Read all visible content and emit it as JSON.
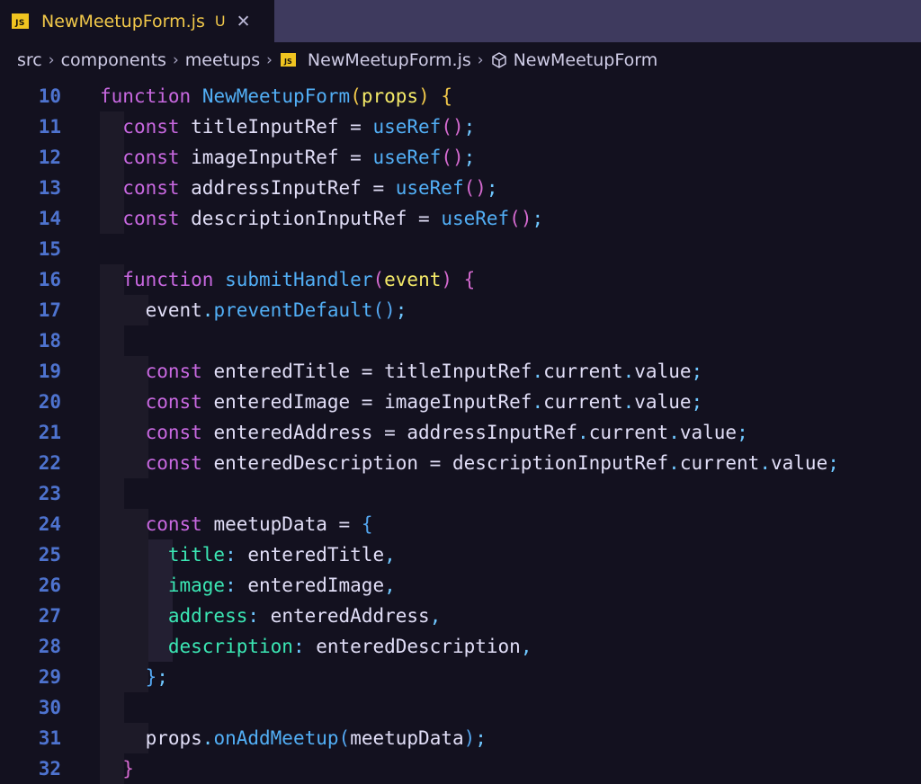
{
  "tab": {
    "badge": "JS",
    "filename": "NewMeetupForm.js",
    "status": "U",
    "close": "✕"
  },
  "breadcrumb": {
    "items": [
      "src",
      "components",
      "meetups",
      "NewMeetupForm.js",
      "NewMeetupForm"
    ],
    "separator": "›",
    "badge": "JS"
  },
  "colors": {
    "keyword": "#c868e0",
    "function": "#52aff6",
    "param": "#f4ea68",
    "property": "#3be7b4",
    "line_number": "#4e73cf",
    "tab_accent": "#f1c84a"
  },
  "editor": {
    "lines": [
      {
        "number": "10",
        "tokens": [
          [
            "kw",
            "function"
          ],
          [
            "tx",
            " "
          ],
          [
            "fn",
            "NewMeetupForm"
          ],
          [
            "br",
            "("
          ],
          [
            "pm",
            "props"
          ],
          [
            "br",
            ")"
          ],
          [
            "tx",
            " "
          ],
          [
            "br",
            "{"
          ]
        ]
      },
      {
        "number": "11",
        "tokens": [
          [
            "tx",
            "  "
          ],
          [
            "kw",
            "const"
          ],
          [
            "tx",
            " titleInputRef = "
          ],
          [
            "fn",
            "useRef"
          ],
          [
            "br2",
            "()"
          ],
          [
            "pu",
            ";"
          ]
        ]
      },
      {
        "number": "12",
        "tokens": [
          [
            "tx",
            "  "
          ],
          [
            "kw",
            "const"
          ],
          [
            "tx",
            " imageInputRef = "
          ],
          [
            "fn",
            "useRef"
          ],
          [
            "br2",
            "()"
          ],
          [
            "pu",
            ";"
          ]
        ]
      },
      {
        "number": "13",
        "tokens": [
          [
            "tx",
            "  "
          ],
          [
            "kw",
            "const"
          ],
          [
            "tx",
            " addressInputRef = "
          ],
          [
            "fn",
            "useRef"
          ],
          [
            "br2",
            "()"
          ],
          [
            "pu",
            ";"
          ]
        ]
      },
      {
        "number": "14",
        "tokens": [
          [
            "tx",
            "  "
          ],
          [
            "kw",
            "const"
          ],
          [
            "tx",
            " descriptionInputRef = "
          ],
          [
            "fn",
            "useRef"
          ],
          [
            "br2",
            "()"
          ],
          [
            "pu",
            ";"
          ]
        ]
      },
      {
        "number": "15",
        "tokens": []
      },
      {
        "number": "16",
        "tokens": [
          [
            "tx",
            "  "
          ],
          [
            "kw",
            "function"
          ],
          [
            "tx",
            " "
          ],
          [
            "fn",
            "submitHandler"
          ],
          [
            "br2",
            "("
          ],
          [
            "pm",
            "event"
          ],
          [
            "br2",
            ")"
          ],
          [
            "tx",
            " "
          ],
          [
            "br2",
            "{"
          ]
        ]
      },
      {
        "number": "17",
        "tokens": [
          [
            "tx",
            "    event"
          ],
          [
            "pu",
            "."
          ],
          [
            "fn",
            "preventDefault"
          ],
          [
            "br3",
            "()"
          ],
          [
            "pu",
            ";"
          ]
        ]
      },
      {
        "number": "18",
        "tokens": []
      },
      {
        "number": "19",
        "tokens": [
          [
            "tx",
            "    "
          ],
          [
            "kw",
            "const"
          ],
          [
            "tx",
            " enteredTitle = titleInputRef"
          ],
          [
            "pu",
            "."
          ],
          [
            "tx",
            "current"
          ],
          [
            "pu",
            "."
          ],
          [
            "tx",
            "value"
          ],
          [
            "pu",
            ";"
          ]
        ]
      },
      {
        "number": "20",
        "tokens": [
          [
            "tx",
            "    "
          ],
          [
            "kw",
            "const"
          ],
          [
            "tx",
            " enteredImage = imageInputRef"
          ],
          [
            "pu",
            "."
          ],
          [
            "tx",
            "current"
          ],
          [
            "pu",
            "."
          ],
          [
            "tx",
            "value"
          ],
          [
            "pu",
            ";"
          ]
        ]
      },
      {
        "number": "21",
        "tokens": [
          [
            "tx",
            "    "
          ],
          [
            "kw",
            "const"
          ],
          [
            "tx",
            " enteredAddress = addressInputRef"
          ],
          [
            "pu",
            "."
          ],
          [
            "tx",
            "current"
          ],
          [
            "pu",
            "."
          ],
          [
            "tx",
            "value"
          ],
          [
            "pu",
            ";"
          ]
        ]
      },
      {
        "number": "22",
        "tokens": [
          [
            "tx",
            "    "
          ],
          [
            "kw",
            "const"
          ],
          [
            "tx",
            " enteredDescription = descriptionInputRef"
          ],
          [
            "pu",
            "."
          ],
          [
            "tx",
            "current"
          ],
          [
            "pu",
            "."
          ],
          [
            "tx",
            "value"
          ],
          [
            "pu",
            ";"
          ]
        ]
      },
      {
        "number": "23",
        "tokens": []
      },
      {
        "number": "24",
        "tokens": [
          [
            "tx",
            "    "
          ],
          [
            "kw",
            "const"
          ],
          [
            "tx",
            " meetupData = "
          ],
          [
            "br3",
            "{"
          ]
        ]
      },
      {
        "number": "25",
        "tokens": [
          [
            "tx",
            "      "
          ],
          [
            "ob",
            "title"
          ],
          [
            "pu",
            ":"
          ],
          [
            "tx",
            " enteredTitle"
          ],
          [
            "pu",
            ","
          ]
        ]
      },
      {
        "number": "26",
        "tokens": [
          [
            "tx",
            "      "
          ],
          [
            "ob",
            "image"
          ],
          [
            "pu",
            ":"
          ],
          [
            "tx",
            " enteredImage"
          ],
          [
            "pu",
            ","
          ]
        ]
      },
      {
        "number": "27",
        "tokens": [
          [
            "tx",
            "      "
          ],
          [
            "ob",
            "address"
          ],
          [
            "pu",
            ":"
          ],
          [
            "tx",
            " enteredAddress"
          ],
          [
            "pu",
            ","
          ]
        ]
      },
      {
        "number": "28",
        "tokens": [
          [
            "tx",
            "      "
          ],
          [
            "ob",
            "description"
          ],
          [
            "pu",
            ":"
          ],
          [
            "tx",
            " enteredDescription"
          ],
          [
            "pu",
            ","
          ]
        ]
      },
      {
        "number": "29",
        "tokens": [
          [
            "tx",
            "    "
          ],
          [
            "br3",
            "}"
          ],
          [
            "pu",
            ";"
          ]
        ]
      },
      {
        "number": "30",
        "tokens": []
      },
      {
        "number": "31",
        "tokens": [
          [
            "tx",
            "    props"
          ],
          [
            "pu",
            "."
          ],
          [
            "fn",
            "onAddMeetup"
          ],
          [
            "br3",
            "("
          ],
          [
            "tx",
            "meetupData"
          ],
          [
            "br3",
            ")"
          ],
          [
            "pu",
            ";"
          ]
        ]
      },
      {
        "number": "32",
        "tokens": [
          [
            "tx",
            "  "
          ],
          [
            "br2",
            "}"
          ]
        ]
      }
    ]
  }
}
